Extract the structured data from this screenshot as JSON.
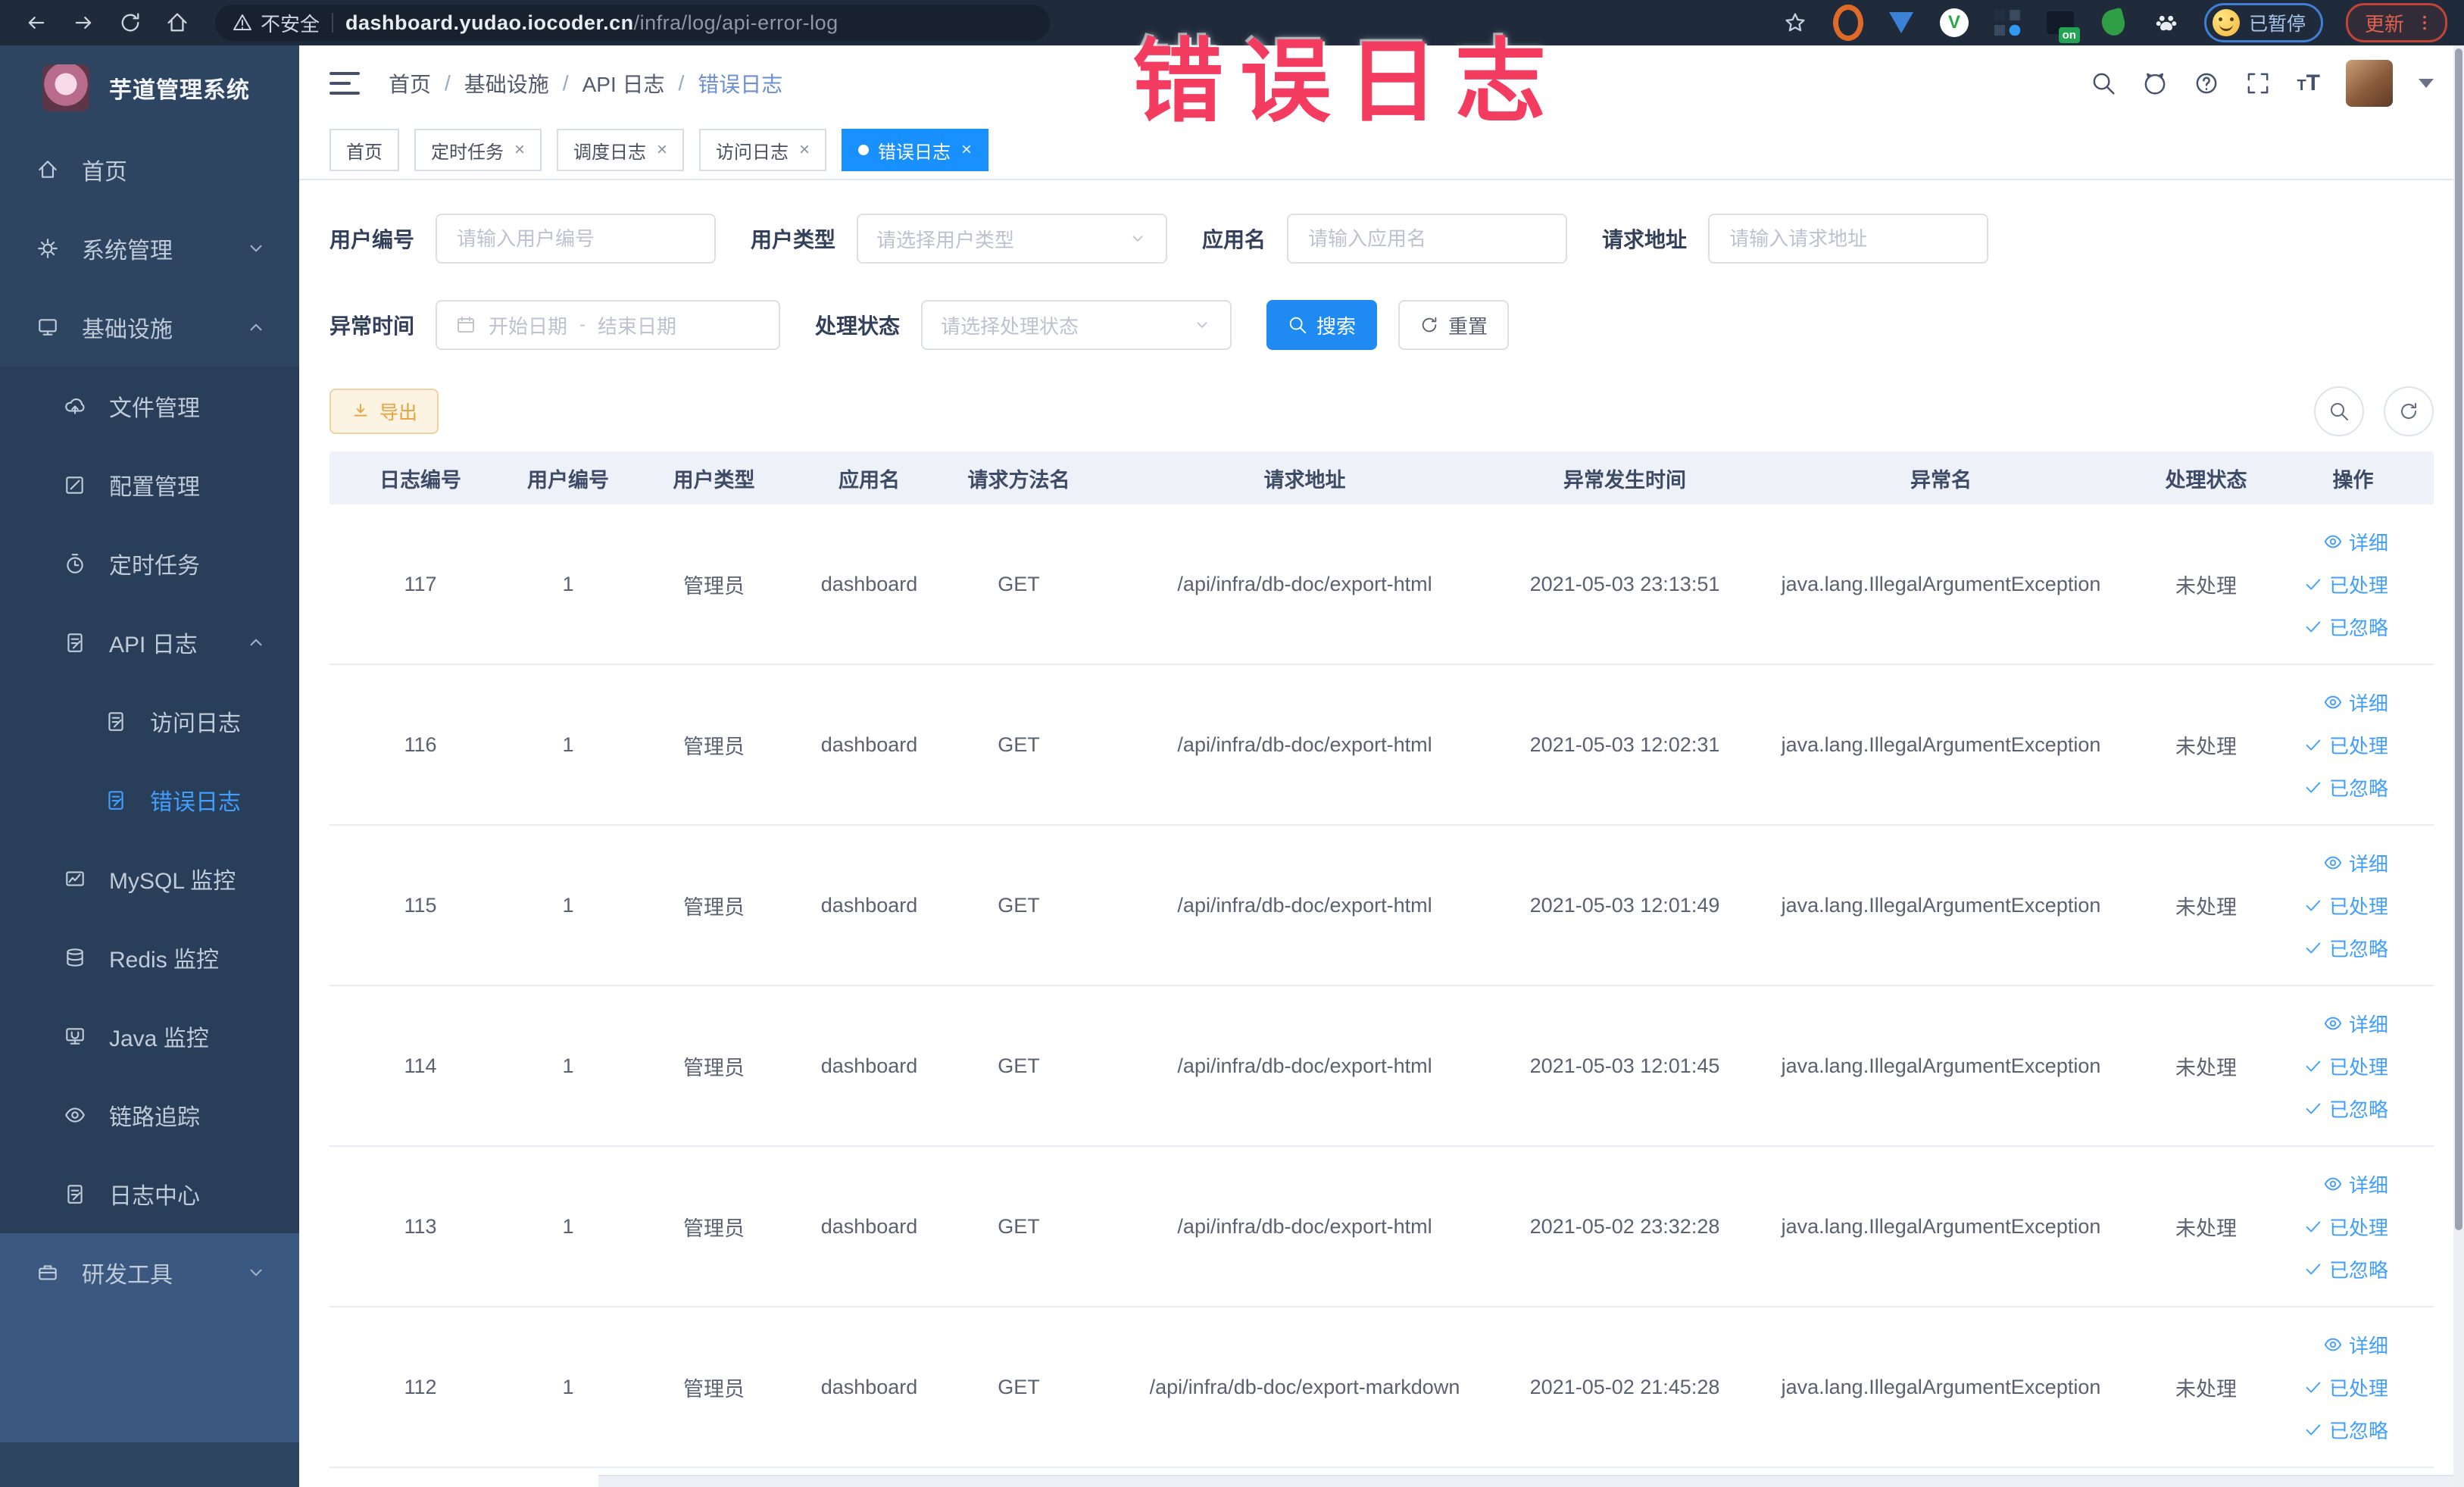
{
  "browser": {
    "security_label": "不安全",
    "url_host": "dashboard.yudao.iocoder.cn",
    "url_path": "/infra/log/api-error-log",
    "paused_badge": "已暂停",
    "update_button": "更新"
  },
  "annotation": {
    "text": "错误日志",
    "color": "#f43b60"
  },
  "sidebar": {
    "title": "芋道管理系统",
    "items": [
      {
        "key": "home",
        "label": "首页",
        "icon": "home-icon",
        "level": 1
      },
      {
        "key": "system-mgmt",
        "label": "系统管理",
        "icon": "gear-icon",
        "level": 1,
        "chevron": "down"
      },
      {
        "key": "infrastructure",
        "label": "基础设施",
        "icon": "monitor-icon",
        "level": 1,
        "chevron": "up"
      },
      {
        "key": "file-mgmt",
        "label": "文件管理",
        "icon": "cloud-upload-icon",
        "level": 2,
        "section": "infra"
      },
      {
        "key": "config-mgmt",
        "label": "配置管理",
        "icon": "edit-icon",
        "level": 2,
        "section": "infra"
      },
      {
        "key": "cron-job",
        "label": "定时任务",
        "icon": "timer-icon",
        "level": 2,
        "section": "infra"
      },
      {
        "key": "api-log",
        "label": "API 日志",
        "icon": "doc-edit-icon",
        "level": 2,
        "chevron": "up",
        "section": "infra"
      },
      {
        "key": "access-log",
        "label": "访问日志",
        "icon": "doc-edit-icon",
        "level": 3,
        "section": "infra"
      },
      {
        "key": "error-log",
        "label": "错误日志",
        "icon": "doc-edit-icon",
        "level": 3,
        "active": true,
        "section": "infra"
      },
      {
        "key": "mysql-monitor",
        "label": "MySQL 监控",
        "icon": "chart-icon",
        "level": 2,
        "section": "infra"
      },
      {
        "key": "redis-monitor",
        "label": "Redis 监控",
        "icon": "redis-icon",
        "level": 2,
        "section": "infra"
      },
      {
        "key": "java-monitor",
        "label": "Java 监控",
        "icon": "java-icon",
        "level": 2,
        "section": "infra"
      },
      {
        "key": "link-trace",
        "label": "链路追踪",
        "icon": "eye-icon",
        "level": 2,
        "section": "infra"
      },
      {
        "key": "log-center",
        "label": "日志中心",
        "icon": "doc-edit-icon",
        "level": 2,
        "section": "infra"
      },
      {
        "key": "dev-tools",
        "label": "研发工具",
        "icon": "briefcase-icon",
        "level": 1,
        "chevron": "down",
        "section": "dev"
      }
    ]
  },
  "breadcrumb": [
    "首页",
    "基础设施",
    "API 日志",
    "错误日志"
  ],
  "tabs": [
    {
      "key": "home",
      "label": "首页",
      "closable": false,
      "active": false
    },
    {
      "key": "cron-job",
      "label": "定时任务",
      "closable": true,
      "active": false
    },
    {
      "key": "schedule-log",
      "label": "调度日志",
      "closable": true,
      "active": false
    },
    {
      "key": "access-log",
      "label": "访问日志",
      "closable": true,
      "active": false
    },
    {
      "key": "error-log",
      "label": "错误日志",
      "closable": true,
      "active": true
    }
  ],
  "filters": {
    "user_id": {
      "label": "用户编号",
      "placeholder": "请输入用户编号"
    },
    "user_type": {
      "label": "用户类型",
      "placeholder": "请选择用户类型"
    },
    "app_name": {
      "label": "应用名",
      "placeholder": "请输入应用名"
    },
    "request_url": {
      "label": "请求地址",
      "placeholder": "请输入请求地址"
    },
    "exception_time": {
      "label": "异常时间",
      "start_placeholder": "开始日期",
      "separator": "-",
      "end_placeholder": "结束日期"
    },
    "process_status": {
      "label": "处理状态",
      "placeholder": "请选择处理状态"
    },
    "search_button": "搜索",
    "reset_button": "重置"
  },
  "toolbar": {
    "export_button": "导出"
  },
  "table": {
    "columns": [
      "日志编号",
      "用户编号",
      "用户类型",
      "应用名",
      "请求方法名",
      "请求地址",
      "异常发生时间",
      "异常名",
      "处理状态",
      "操作"
    ],
    "action_labels": [
      "详细",
      "已处理",
      "已忽略"
    ],
    "rows": [
      {
        "log_id": "117",
        "user_id": "1",
        "user_type": "管理员",
        "app_name": "dashboard",
        "method": "GET",
        "url": "/api/infra/db-doc/export-html",
        "time": "2021-05-03 23:13:51",
        "exception": "java.lang.IllegalArgumentException",
        "status": "未处理"
      },
      {
        "log_id": "116",
        "user_id": "1",
        "user_type": "管理员",
        "app_name": "dashboard",
        "method": "GET",
        "url": "/api/infra/db-doc/export-html",
        "time": "2021-05-03 12:02:31",
        "exception": "java.lang.IllegalArgumentException",
        "status": "未处理"
      },
      {
        "log_id": "115",
        "user_id": "1",
        "user_type": "管理员",
        "app_name": "dashboard",
        "method": "GET",
        "url": "/api/infra/db-doc/export-html",
        "time": "2021-05-03 12:01:49",
        "exception": "java.lang.IllegalArgumentException",
        "status": "未处理"
      },
      {
        "log_id": "114",
        "user_id": "1",
        "user_type": "管理员",
        "app_name": "dashboard",
        "method": "GET",
        "url": "/api/infra/db-doc/export-html",
        "time": "2021-05-03 12:01:45",
        "exception": "java.lang.IllegalArgumentException",
        "status": "未处理"
      },
      {
        "log_id": "113",
        "user_id": "1",
        "user_type": "管理员",
        "app_name": "dashboard",
        "method": "GET",
        "url": "/api/infra/db-doc/export-html",
        "time": "2021-05-02 23:32:28",
        "exception": "java.lang.IllegalArgumentException",
        "status": "未处理"
      },
      {
        "log_id": "112",
        "user_id": "1",
        "user_type": "管理员",
        "app_name": "dashboard",
        "method": "GET",
        "url": "/api/infra/db-doc/export-markdown",
        "time": "2021-05-02 21:45:28",
        "exception": "java.lang.IllegalArgumentException",
        "status": "未处理"
      }
    ]
  },
  "colors": {
    "accent": "#1890ff",
    "link": "#409eff",
    "warning": "#e6a23c",
    "annotation": "#f43b60"
  }
}
